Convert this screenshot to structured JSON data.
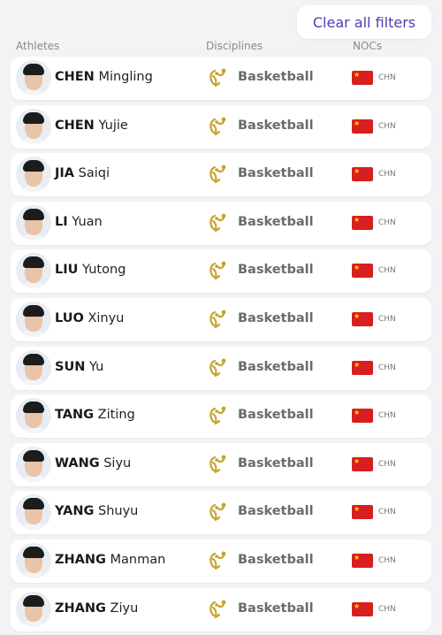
{
  "header": {
    "clear_label": "Clear all filters",
    "columns": {
      "athletes": "Athletes",
      "disciplines": "Disciplines",
      "nocs": "NOCs"
    }
  },
  "athletes": [
    {
      "surname": "CHEN",
      "given": "Mingling",
      "discipline": "Basketball",
      "noc": "CHN"
    },
    {
      "surname": "CHEN",
      "given": "Yujie",
      "discipline": "Basketball",
      "noc": "CHN"
    },
    {
      "surname": "JIA",
      "given": "Saiqi",
      "discipline": "Basketball",
      "noc": "CHN"
    },
    {
      "surname": "LI",
      "given": "Yuan",
      "discipline": "Basketball",
      "noc": "CHN"
    },
    {
      "surname": "LIU",
      "given": "Yutong",
      "discipline": "Basketball",
      "noc": "CHN"
    },
    {
      "surname": "LUO",
      "given": "Xinyu",
      "discipline": "Basketball",
      "noc": "CHN"
    },
    {
      "surname": "SUN",
      "given": "Yu",
      "discipline": "Basketball",
      "noc": "CHN"
    },
    {
      "surname": "TANG",
      "given": "Ziting",
      "discipline": "Basketball",
      "noc": "CHN"
    },
    {
      "surname": "WANG",
      "given": "Siyu",
      "discipline": "Basketball",
      "noc": "CHN"
    },
    {
      "surname": "YANG",
      "given": "Shuyu",
      "discipline": "Basketball",
      "noc": "CHN"
    },
    {
      "surname": "ZHANG",
      "given": "Manman",
      "discipline": "Basketball",
      "noc": "CHN"
    },
    {
      "surname": "ZHANG",
      "given": "Ziyu",
      "discipline": "Basketball",
      "noc": "CHN"
    }
  ],
  "colors": {
    "accent": "#4b3fb5",
    "flag_red": "#d71f1f",
    "icon_gold": "#c9a227"
  }
}
